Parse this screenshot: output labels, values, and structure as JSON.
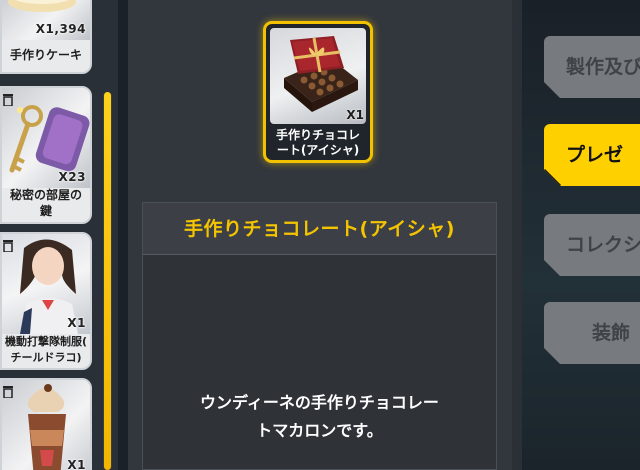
{
  "inventory": [
    {
      "name": "手作りケーキ",
      "qty": "X1,394"
    },
    {
      "name_line1": "秘密の部屋の",
      "name_line2": "鍵",
      "qty": "X23"
    },
    {
      "name_line1": "機動打撃隊制服(",
      "name_line2": "チールドラコ)",
      "qty": "X1"
    },
    {
      "qty": "X1"
    }
  ],
  "selected": {
    "name_line1": "手作りチョコレ",
    "name_line2": "ート(アイシャ)",
    "qty": "X1"
  },
  "detail": {
    "title": "手作りチョコレート(アイシャ)",
    "desc_line1": "ウンディーネの手作りチョコレー",
    "desc_line2": "トマカロンです。"
  },
  "tabs": [
    {
      "label": "製作及び"
    },
    {
      "label": "プレゼ"
    },
    {
      "label": "コレクシ"
    },
    {
      "label": "装飾"
    }
  ],
  "colors": {
    "accent": "#ffd000",
    "title_text": "#f5c400"
  }
}
